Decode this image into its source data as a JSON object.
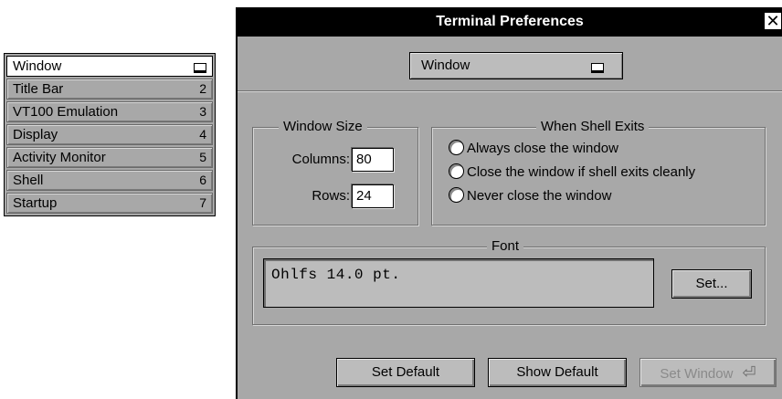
{
  "menu": {
    "items": [
      {
        "label": "Window",
        "key": "",
        "selected": true
      },
      {
        "label": "Title Bar",
        "key": "2"
      },
      {
        "label": "VT100 Emulation",
        "key": "3"
      },
      {
        "label": "Display",
        "key": "4"
      },
      {
        "label": "Activity Monitor",
        "key": "5"
      },
      {
        "label": "Shell",
        "key": "6"
      },
      {
        "label": "Startup",
        "key": "7"
      }
    ]
  },
  "dialog": {
    "title": "Terminal Preferences",
    "section_popup": "Window",
    "window_size": {
      "title": "Window Size",
      "columns_label": "Columns:",
      "columns_value": "80",
      "rows_label": "Rows:",
      "rows_value": "24"
    },
    "shell_exit": {
      "title": "When Shell Exits",
      "options": [
        "Always close the window",
        "Close the window if shell exits cleanly",
        "Never close the window"
      ]
    },
    "font": {
      "title": "Font",
      "value": "Ohlfs 14.0 pt.",
      "set_button": "Set..."
    },
    "buttons": {
      "set_default": "Set Default",
      "show_default": "Show Default",
      "set_window": "Set Window"
    }
  }
}
